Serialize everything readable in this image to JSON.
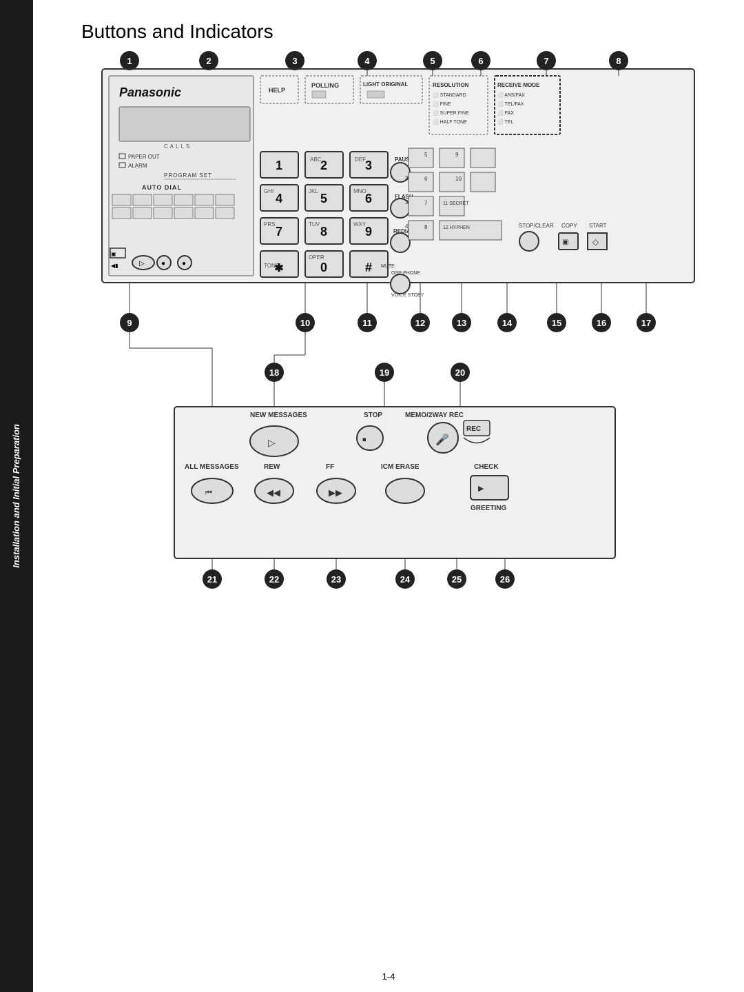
{
  "sidebar": {
    "text": "Installation and Initial\nPreparation"
  },
  "page": {
    "title": "Buttons and Indicators",
    "number": "1-4"
  },
  "numbers_top": [
    "1",
    "2",
    "3",
    "4",
    "5",
    "6",
    "7",
    "8"
  ],
  "numbers_bottom_row1": [
    "9",
    "10",
    "11",
    "12",
    "13",
    "14",
    "15",
    "16",
    "17"
  ],
  "numbers_bottom_row2": [
    "18",
    "19",
    "20"
  ],
  "numbers_bottom_row3": [
    "21",
    "22",
    "23",
    "24",
    "25",
    "26"
  ],
  "labels": {
    "panasonic": "Panasonic",
    "calls": "CALLS",
    "paper_out": "PAPER OUT",
    "alarm": "ALARM",
    "program_set": "PROGRAM  SET",
    "auto_dial": "AUTO DIAL",
    "polling": "POLLING",
    "light_original": "LIGHT ORIGINAL",
    "resolution": "RESOLUTION",
    "receive_mode": "RECEIVE MODE",
    "help": "HELP",
    "standard": "STANDARD",
    "fine": "FINE",
    "super_fine": "SUPER FINE",
    "half_tone": "HALF TONE",
    "ans_fax": "ANS/FAX",
    "tel_fax": "TEL/FAX",
    "fax": "FAX",
    "tel": "TEL",
    "pause": "PAUSE",
    "flash": "FLASH",
    "redial": "REDIAL",
    "mute": "MUTE",
    "osp_phone": "OSP·PHONE",
    "stop_clear": "STOP/CLEAR",
    "copy": "COPY",
    "start": "START",
    "voice_stoby": "VOICE STOBY",
    "secret": "11 SECRET",
    "hyphen": "12 HYPHEN",
    "tone": "TONE",
    "new_messages": "NEW MESSAGES",
    "stop": "STOP",
    "memo_2way_rec": "MEMO/2WAY REC",
    "rec": "REC",
    "all_messages": "ALL MESSAGES",
    "rew": "REW",
    "ff": "FF",
    "icm_erase": "ICM ERASE",
    "check": "CHECK",
    "greeting": "GREETING"
  },
  "keypad": [
    {
      "label": "1",
      "sub": ""
    },
    {
      "label": "2",
      "sub": "ABC"
    },
    {
      "label": "3",
      "sub": "DEF"
    },
    {
      "label": "4",
      "sub": "GHI"
    },
    {
      "label": "5",
      "sub": "JKL"
    },
    {
      "label": "6",
      "sub": "MNO"
    },
    {
      "label": "7",
      "sub": "PRS"
    },
    {
      "label": "8",
      "sub": "TUV"
    },
    {
      "label": "9",
      "sub": "WXY"
    },
    {
      "label": "★",
      "sub": "TONE"
    },
    {
      "label": "0",
      "sub": "OPER"
    },
    {
      "label": "#",
      "sub": ""
    }
  ]
}
